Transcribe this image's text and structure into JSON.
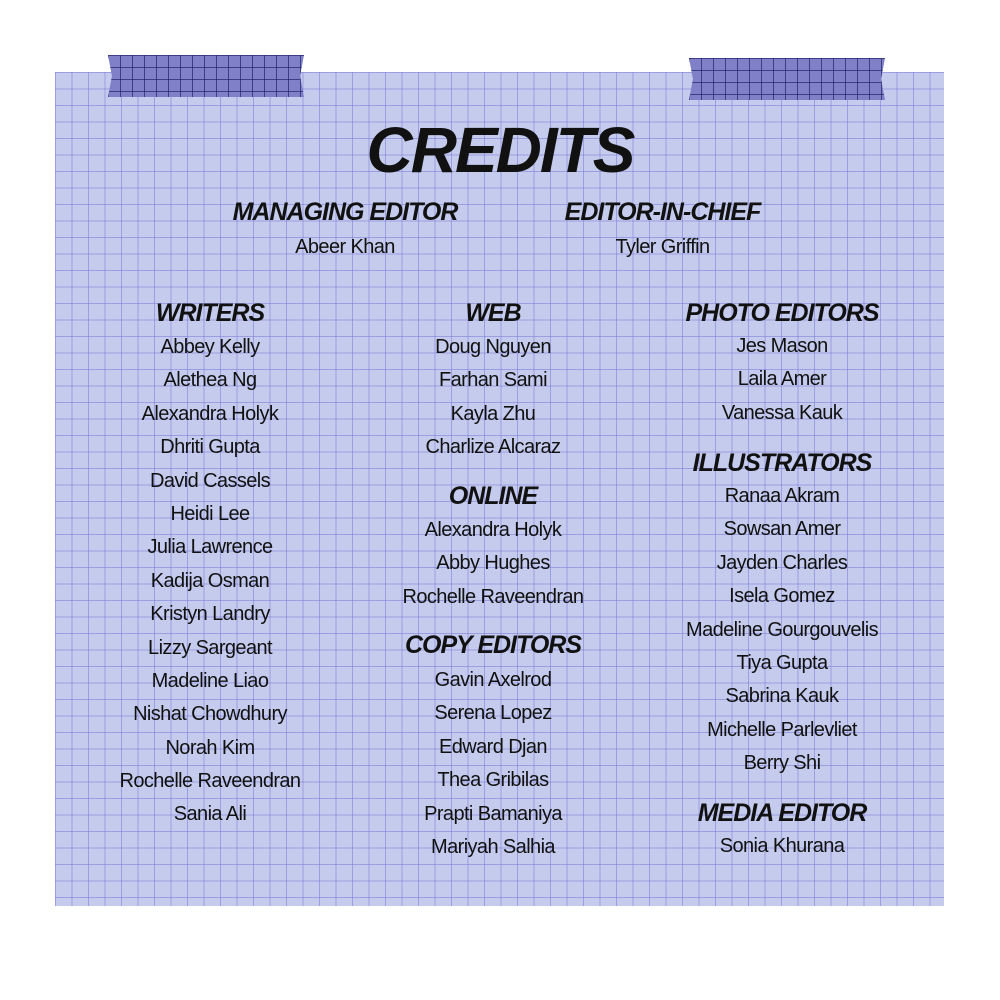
{
  "title": "CREDITS",
  "managing_editor": {
    "heading": "MANAGING EDITOR",
    "names": [
      "Abeer Khan"
    ]
  },
  "editor_in_chief": {
    "heading": "EDITOR-IN-CHIEF",
    "names": [
      "Tyler Griffin"
    ]
  },
  "writers": {
    "heading": "WRITERS",
    "names": [
      "Abbey Kelly",
      "Alethea Ng",
      "Alexandra Holyk",
      "Dhriti Gupta",
      "David Cassels",
      "Heidi Lee",
      "Julia Lawrence",
      "Kadija Osman",
      "Kristyn Landry",
      "Lizzy Sargeant",
      "Madeline Liao",
      "Nishat Chowdhury",
      "Norah Kim",
      "Rochelle Raveendran",
      "Sania Ali"
    ]
  },
  "web": {
    "heading": "WEB",
    "names": [
      "Doug Nguyen",
      "Farhan Sami",
      "Kayla Zhu",
      "Charlize Alcaraz"
    ]
  },
  "online": {
    "heading": "ONLINE",
    "names": [
      "Alexandra Holyk",
      "Abby Hughes",
      "Rochelle Raveendran"
    ]
  },
  "copy_editors": {
    "heading": "COPY EDITORS",
    "names": [
      "Gavin Axelrod",
      "Serena Lopez",
      "Edward Djan",
      "Thea Gribilas",
      "Prapti Bamaniya",
      "Mariyah Salhia"
    ]
  },
  "photo_editors": {
    "heading": "PHOTO EDITORS",
    "names": [
      "Jes Mason",
      "Laila Amer",
      "Vanessa Kauk"
    ]
  },
  "illustrators": {
    "heading": "ILLUSTRATORS",
    "names": [
      "Ranaa Akram",
      "Sowsan Amer",
      "Jayden Charles",
      "Isela Gomez",
      "Madeline Gourgouvelis",
      "Tiya Gupta",
      "Sabrina Kauk",
      "Michelle Parlevliet",
      "Berry Shi"
    ]
  },
  "media_editor": {
    "heading": "MEDIA EDITOR",
    "names": [
      "Sonia Khurana"
    ]
  },
  "colors": {
    "paper": "#c5cbec",
    "grid": "#7878d7",
    "tape": "#7f80c8",
    "text": "#111111"
  }
}
